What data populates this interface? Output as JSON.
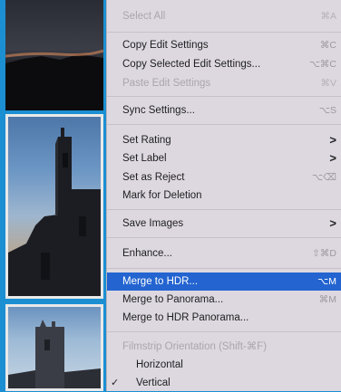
{
  "menu": {
    "items": [
      {
        "label": "Select All",
        "shortcut": "⌘A"
      },
      {
        "label": "Copy Edit Settings",
        "shortcut": "⌘C"
      },
      {
        "label": "Copy Selected Edit Settings...",
        "shortcut": "⌥⌘C"
      },
      {
        "label": "Paste Edit Settings",
        "shortcut": "⌘V"
      },
      {
        "label": "Sync Settings...",
        "shortcut": "⌥S"
      },
      {
        "label": "Set Rating",
        "shortcut": ">"
      },
      {
        "label": "Set Label",
        "shortcut": ">"
      },
      {
        "label": "Set as Reject",
        "shortcut": "⌥⌫"
      },
      {
        "label": "Mark for Deletion",
        "shortcut": ""
      },
      {
        "label": "Save Images",
        "shortcut": ">"
      },
      {
        "label": "Enhance...",
        "shortcut": "⇧⌘D"
      },
      {
        "label": "Merge to HDR...",
        "shortcut": "⌥M"
      },
      {
        "label": "Merge to Panorama...",
        "shortcut": "⌘M"
      },
      {
        "label": "Merge to HDR Panorama...",
        "shortcut": ""
      },
      {
        "label": "Filmstrip Orientation (Shift-⌘F)",
        "shortcut": ""
      },
      {
        "label": "Horizontal",
        "shortcut": ""
      },
      {
        "label": "Vertical",
        "shortcut": "",
        "check": "✓"
      }
    ]
  }
}
